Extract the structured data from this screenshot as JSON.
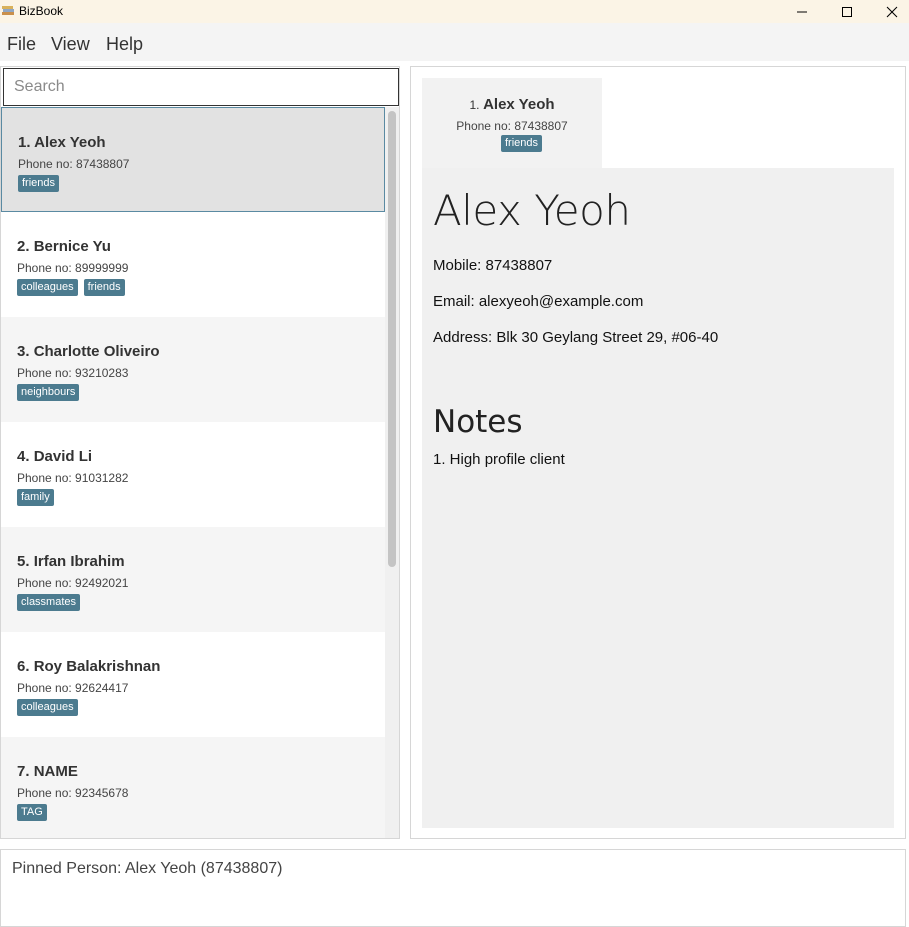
{
  "window": {
    "title": "BizBook"
  },
  "menu": {
    "file": "File",
    "view": "View",
    "help": "Help"
  },
  "search": {
    "placeholder": "Search",
    "value": ""
  },
  "persons": [
    {
      "index": "1.",
      "name": "Alex Yeoh",
      "phone": "Phone no: 87438807",
      "tags": [
        "friends"
      ],
      "selected": true
    },
    {
      "index": "2.",
      "name": "Bernice Yu",
      "phone": "Phone no: 89999999",
      "tags": [
        "colleagues",
        "friends"
      ]
    },
    {
      "index": "3.",
      "name": "Charlotte Oliveiro",
      "phone": "Phone no: 93210283",
      "tags": [
        "neighbours"
      ]
    },
    {
      "index": "4.",
      "name": "David Li",
      "phone": "Phone no: 91031282",
      "tags": [
        "family"
      ]
    },
    {
      "index": "5.",
      "name": "Irfan Ibrahim",
      "phone": "Phone no: 92492021",
      "tags": [
        "classmates"
      ]
    },
    {
      "index": "6.",
      "name": "Roy Balakrishnan",
      "phone": "Phone no: 92624417",
      "tags": [
        "colleagues"
      ]
    },
    {
      "index": "7.",
      "name": "NAME",
      "phone": "Phone no: 92345678",
      "tags": [
        "TAG"
      ]
    }
  ],
  "pinned": {
    "index": "1.",
    "name": "Alex Yeoh",
    "phone": "Phone no: 87438807",
    "tag": "friends"
  },
  "detail": {
    "name": "Alex Yeoh",
    "mobile": "Mobile: 87438807",
    "email": "Email: alexyeoh@example.com",
    "address": "Address: Blk 30 Geylang Street 29, #06-40",
    "notes_title": "Notes",
    "notes": [
      "1. High profile client"
    ]
  },
  "result": {
    "text": "Pinned Person: Alex Yeoh (87438807)"
  },
  "colors": {
    "tag": "#4c7b8f",
    "selected_border": "#5a8aa2",
    "titlebar": "#fbf4e6"
  }
}
